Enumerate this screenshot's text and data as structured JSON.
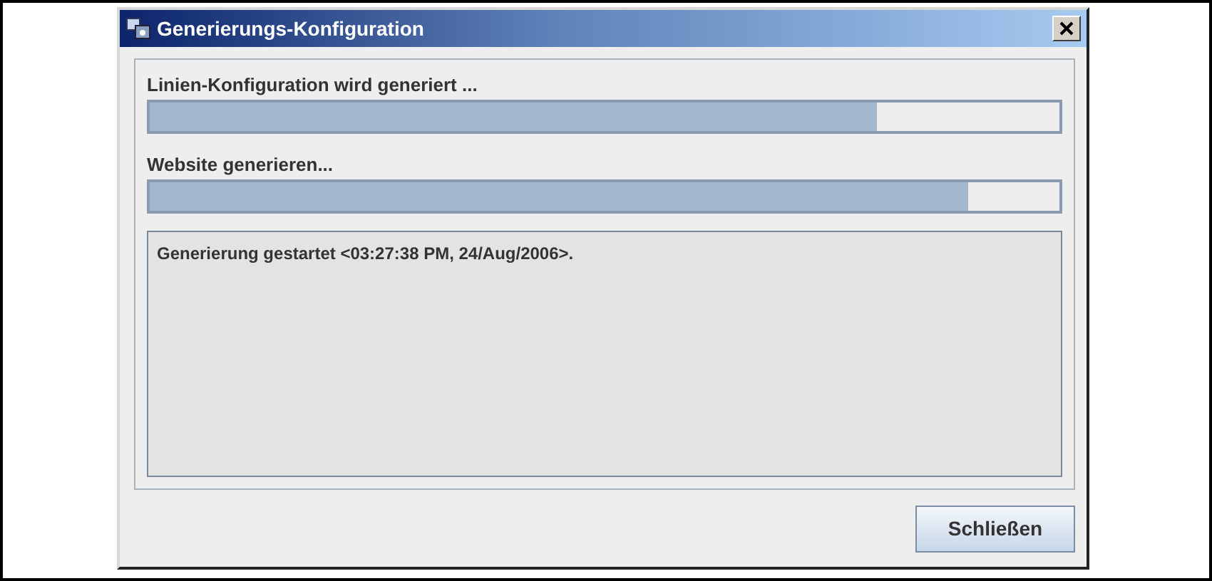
{
  "window": {
    "title": "Generierungs-Konfiguration"
  },
  "tasks": [
    {
      "label": "Linien-Konfiguration wird generiert ...",
      "level": 0.8
    },
    {
      "label": "Website generieren...",
      "level": 0.9
    }
  ],
  "log": {
    "text": "Generierung gestartet <03:27:38 PM, 24/Aug/2006>."
  },
  "buttons": [
    "Schließen"
  ]
}
